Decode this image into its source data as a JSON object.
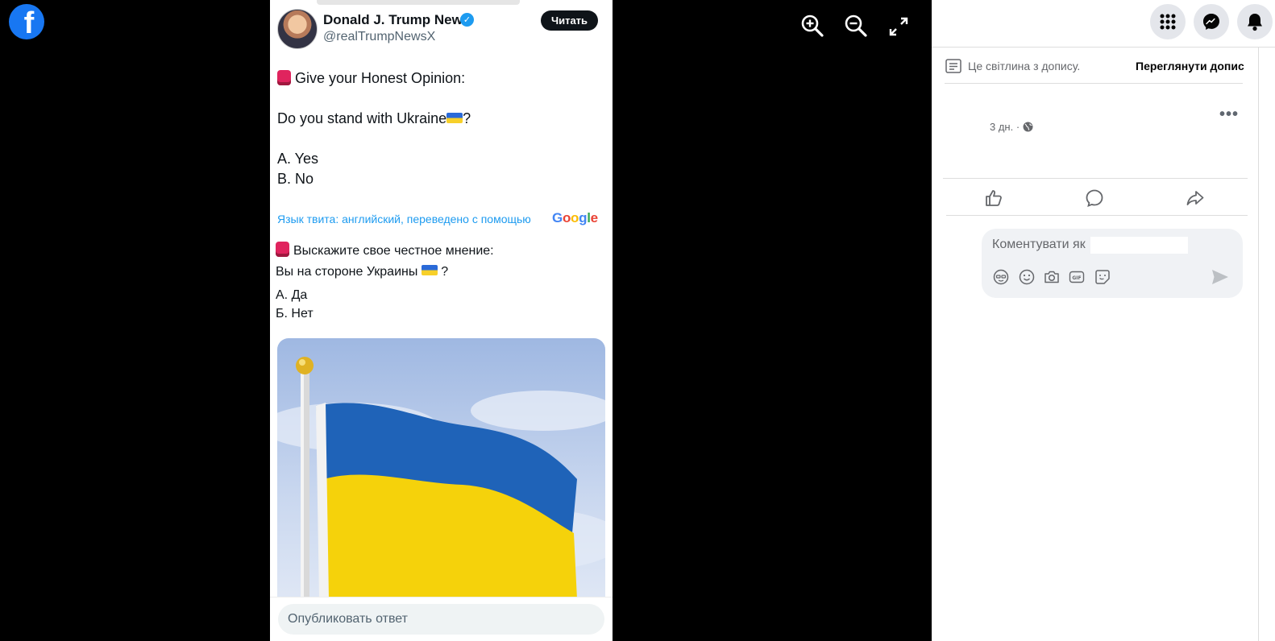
{
  "tweet": {
    "author_name": "Donald J. Trump News",
    "handle": "@realTrumpNewsX",
    "read_button": "Читать",
    "lines_en": [
      "Give your Honest Opinion:",
      "Do you stand with Ukraine",
      "?",
      "A. Yes",
      "B. No"
    ],
    "translation_note": "Язык твита: английский, переведено с помощью",
    "translation_brand": [
      "G",
      "o",
      "o",
      "g",
      "l",
      "e"
    ],
    "lines_ru": [
      "Выскажите свое честное мнение:",
      "Вы на стороне Украины",
      "?",
      "А. Да",
      "Б. Нет"
    ],
    "reply_placeholder": "Опубликовать ответ"
  },
  "panel": {
    "info_text": "Це світлина з допису.",
    "view_post": "Переглянути допис",
    "post_time": "3 дн. ·",
    "comment_placeholder": "Коментувати як"
  },
  "icons": [
    "facebook-logo-icon",
    "zoom-in-icon",
    "zoom-out-icon",
    "fullscreen-icon",
    "apps-grid-icon",
    "messenger-icon",
    "bell-icon",
    "document-icon",
    "globe-icon",
    "more-icon",
    "like-icon",
    "comment-icon",
    "share-icon",
    "avatar-sticker-icon",
    "emoji-icon",
    "camera-icon",
    "gif-icon",
    "sticker-icon",
    "send-icon",
    "verified-badge-icon",
    "siren-icon",
    "ukraine-flag-icon"
  ],
  "colors": {
    "facebook_blue": "#1877f2",
    "twitter_blue": "#1d9bf0",
    "flag_blue": "#0057b7",
    "flag_yellow": "#ffd700"
  }
}
